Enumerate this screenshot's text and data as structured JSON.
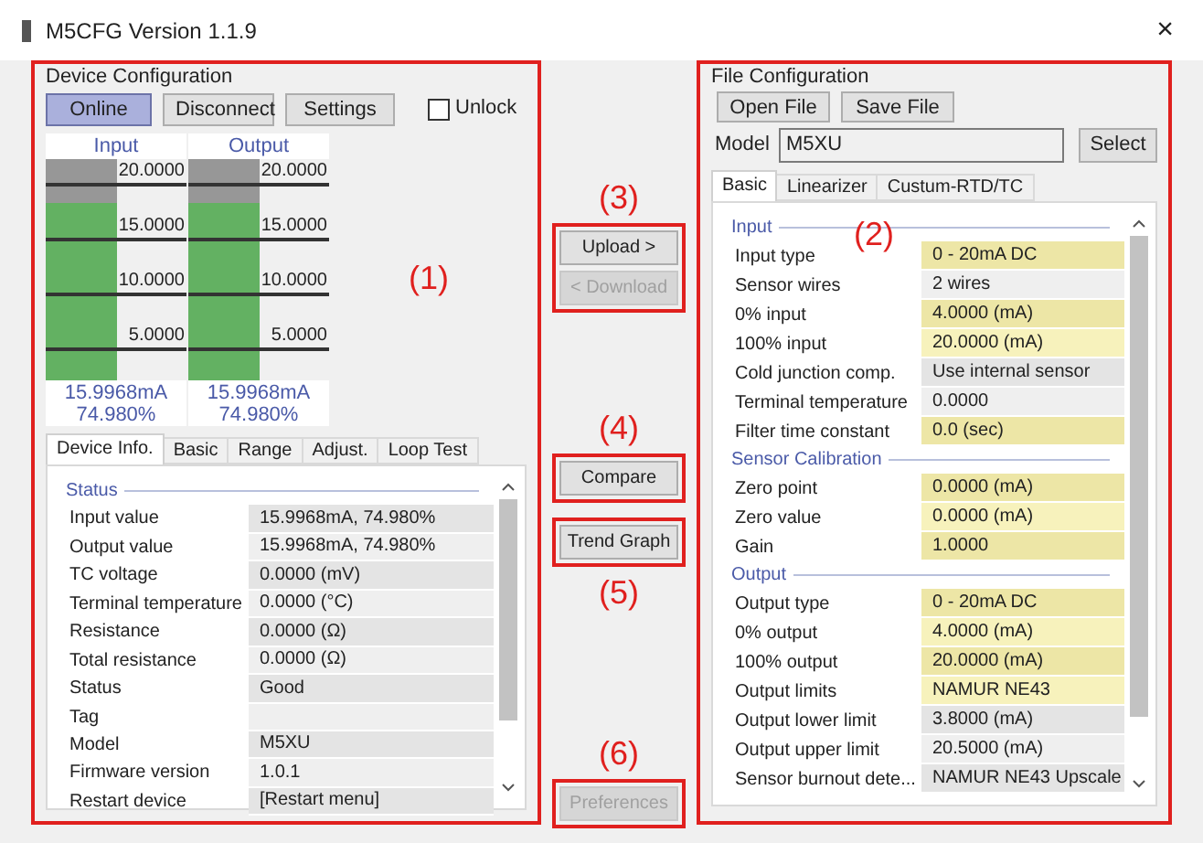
{
  "window": {
    "title": "M5CFG Version 1.1.9",
    "close": "×"
  },
  "device_configuration": {
    "title": "Device Configuration",
    "annotation": "(1)",
    "buttons": [
      {
        "label": "Online",
        "selected": true
      },
      {
        "label": "Disconnect",
        "selected": false
      },
      {
        "label": "Settings",
        "selected": false
      }
    ],
    "unlock": {
      "label": "Unlock",
      "checked": false
    },
    "meters": [
      {
        "title": "Input",
        "level": 0.7998,
        "ticks": [
          "20.0000",
          "15.0000",
          "10.0000",
          "5.0000"
        ],
        "reading": "15.9968mA",
        "percent": "74.980%"
      },
      {
        "title": "Output",
        "level": 0.7998,
        "ticks": [
          "20.0000",
          "15.0000",
          "10.0000",
          "5.0000"
        ],
        "reading": "15.9968mA",
        "percent": "74.980%"
      }
    ],
    "tabs": [
      {
        "label": "Device Info.",
        "selected": true
      },
      {
        "label": "Basic",
        "selected": false
      },
      {
        "label": "Range",
        "selected": false
      },
      {
        "label": "Adjust.",
        "selected": false
      },
      {
        "label": "Loop Test",
        "selected": false
      }
    ],
    "sections": [
      {
        "title": "Status",
        "rows": [
          {
            "label": "Input value",
            "value": "15.9968mA, 74.980%",
            "kind": "readonly"
          },
          {
            "label": "Output value",
            "value": "15.9968mA, 74.980%",
            "kind": "readonly"
          },
          {
            "label": "TC voltage",
            "value": "0.0000 (mV)",
            "kind": "readonly"
          },
          {
            "label": "Terminal temperature",
            "value": "0.0000 (°C)",
            "kind": "readonly"
          },
          {
            "label": "Resistance",
            "value": "0.0000 (Ω)",
            "kind": "readonly"
          },
          {
            "label": "Total resistance",
            "value": "0.0000 (Ω)",
            "kind": "readonly"
          },
          {
            "label": "Status",
            "value": "Good",
            "kind": "readonly"
          },
          {
            "label": "Tag",
            "value": "",
            "kind": "readonly"
          },
          {
            "label": "Model",
            "value": "M5XU",
            "kind": "readonly"
          },
          {
            "label": "Firmware version",
            "value": "1.0.1",
            "kind": "readonly"
          },
          {
            "label": "Restart device",
            "value": "[Restart menu]",
            "kind": "readonly"
          }
        ]
      }
    ]
  },
  "actions": [
    {
      "annotation_above": "(3)",
      "buttons": [
        {
          "label": "Upload >",
          "disabled": false
        },
        {
          "label": "< Download",
          "disabled": true
        }
      ]
    },
    {
      "annotation_above": "(4)",
      "buttons": [
        {
          "label": "Compare",
          "disabled": false
        }
      ]
    },
    {
      "annotation_below": "(5)",
      "buttons": [
        {
          "label": "Trend Graph",
          "disabled": false
        }
      ]
    },
    {
      "annotation_above": "(6)",
      "buttons": [
        {
          "label": "Preferences",
          "disabled": true
        }
      ]
    }
  ],
  "file_configuration": {
    "title": "File Configuration",
    "annotation": "(2)",
    "buttons": [
      "Open File",
      "Save File"
    ],
    "model": {
      "label": "Model",
      "value": "M5XU",
      "button": "Select"
    },
    "tabs": [
      {
        "label": "Basic",
        "selected": true
      },
      {
        "label": "Linearizer",
        "selected": false
      },
      {
        "label": "Custum-RTD/TC",
        "selected": false
      }
    ],
    "sections": [
      {
        "title": "Input",
        "rows": [
          {
            "label": "Input type",
            "value": "0 - 20mA DC",
            "kind": "editable"
          },
          {
            "label": "Sensor wires",
            "value": "2 wires",
            "kind": "readonly"
          },
          {
            "label": "0% input",
            "value": "4.0000 (mA)",
            "kind": "editable"
          },
          {
            "label": "100% input",
            "value": "20.0000 (mA)",
            "kind": "editable"
          },
          {
            "label": "Cold junction comp.",
            "value": "Use internal sensor",
            "kind": "readonly"
          },
          {
            "label": "Terminal temperature",
            "value": "0.0000",
            "kind": "readonly"
          },
          {
            "label": "Filter time constant",
            "value": "0.0 (sec)",
            "kind": "editable"
          }
        ]
      },
      {
        "title": "Sensor Calibration",
        "rows": [
          {
            "label": "Zero point",
            "value": "0.0000 (mA)",
            "kind": "editable"
          },
          {
            "label": "Zero value",
            "value": "0.0000 (mA)",
            "kind": "editable"
          },
          {
            "label": "Gain",
            "value": "1.0000",
            "kind": "editable"
          }
        ]
      },
      {
        "title": "Output",
        "rows": [
          {
            "label": "Output type",
            "value": "0 - 20mA DC",
            "kind": "editable"
          },
          {
            "label": "0% output",
            "value": "4.0000 (mA)",
            "kind": "editable"
          },
          {
            "label": "100% output",
            "value": "20.0000 (mA)",
            "kind": "editable"
          },
          {
            "label": "Output limits",
            "value": "NAMUR NE43",
            "kind": "editable"
          },
          {
            "label": "Output lower limit",
            "value": "3.8000 (mA)",
            "kind": "readonly"
          },
          {
            "label": "Output upper limit",
            "value": "20.5000 (mA)",
            "kind": "readonly"
          },
          {
            "label": "Sensor burnout dete...",
            "value": "NAMUR NE43 Upscale",
            "kind": "readonly"
          }
        ]
      }
    ]
  }
}
